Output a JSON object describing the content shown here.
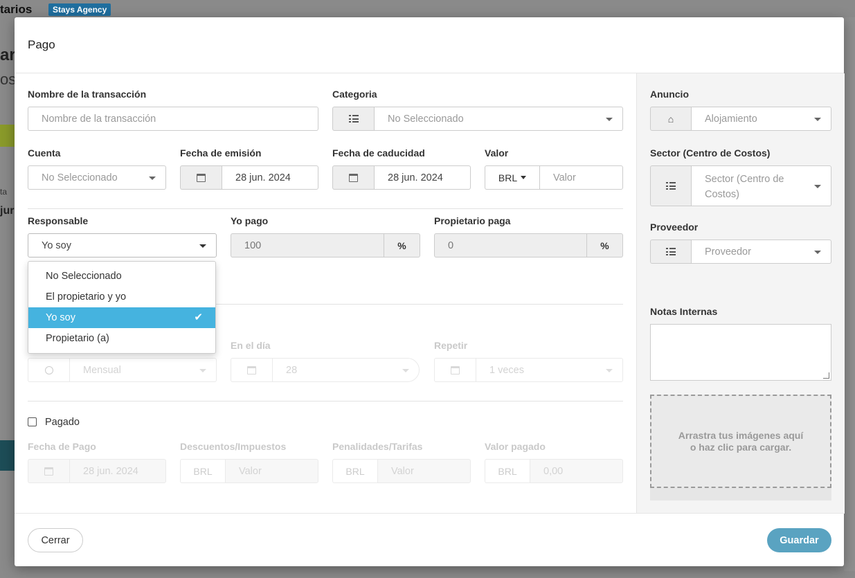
{
  "background": {
    "title": "tarios",
    "badge": "Stays Agency",
    "big1": "ari",
    "big2": "os",
    "ta": "ta",
    "jun": "jur"
  },
  "modal": {
    "title": "Pago"
  },
  "transaction_name": {
    "label": "Nombre de la transacción",
    "placeholder": "Nombre de la transacción"
  },
  "category": {
    "label": "Categoria",
    "value": "No Seleccionado"
  },
  "account": {
    "label": "Cuenta",
    "value": "No Seleccionado"
  },
  "issue_date": {
    "label": "Fecha de emisión",
    "value": "28 jun. 2024"
  },
  "due_date": {
    "label": "Fecha de caducidad",
    "value": "28 jun. 2024"
  },
  "amount": {
    "label": "Valor",
    "currency": "BRL",
    "placeholder": "Valor"
  },
  "responsible": {
    "label": "Responsable",
    "value": "Yo soy",
    "options": [
      "No Seleccionado",
      "El propietario y yo",
      "Yo soy",
      "Propietario (a)"
    ]
  },
  "i_pay": {
    "label": "Yo pago",
    "value": "100",
    "unit": "%"
  },
  "owner_pays": {
    "label": "Propietario paga",
    "value": "0",
    "unit": "%"
  },
  "recurrence": {
    "frequency": "Mensual",
    "day_label": "En el día",
    "day": "28",
    "repeat_label": "Repetir",
    "repeat": "1 veces"
  },
  "paid": {
    "label": "Pagado"
  },
  "payment": {
    "date_label": "Fecha de Pago",
    "date": "28 jun. 2024",
    "discounts_label": "Descuentos/Impuestos",
    "discounts_currency": "BRL",
    "discounts_placeholder": "Valor",
    "penalties_label": "Penalidades/Tarifas",
    "penalties_currency": "BRL",
    "penalties_placeholder": "Valor",
    "paid_label": "Valor pagado",
    "paid_currency": "BRL",
    "paid_value": "0,00"
  },
  "listing": {
    "label": "Anuncio",
    "placeholder": "Alojamiento"
  },
  "sector": {
    "label": "Sector (Centro de Costos)",
    "placeholder_line1": "Sector (Centro de",
    "placeholder_line2": "Costos)"
  },
  "provider": {
    "label": "Proveedor",
    "placeholder": "Proveedor"
  },
  "notes": {
    "label": "Notas Internas"
  },
  "dropzone": {
    "line1": "Arrastra tus imágenes aquí",
    "line2": "o haz clic para cargar."
  },
  "footer": {
    "close": "Cerrar",
    "save": "Guardar"
  },
  "colors": {
    "primary": "#5aa3c1",
    "highlight": "#45b3df",
    "badge": "#1f6e9e"
  }
}
